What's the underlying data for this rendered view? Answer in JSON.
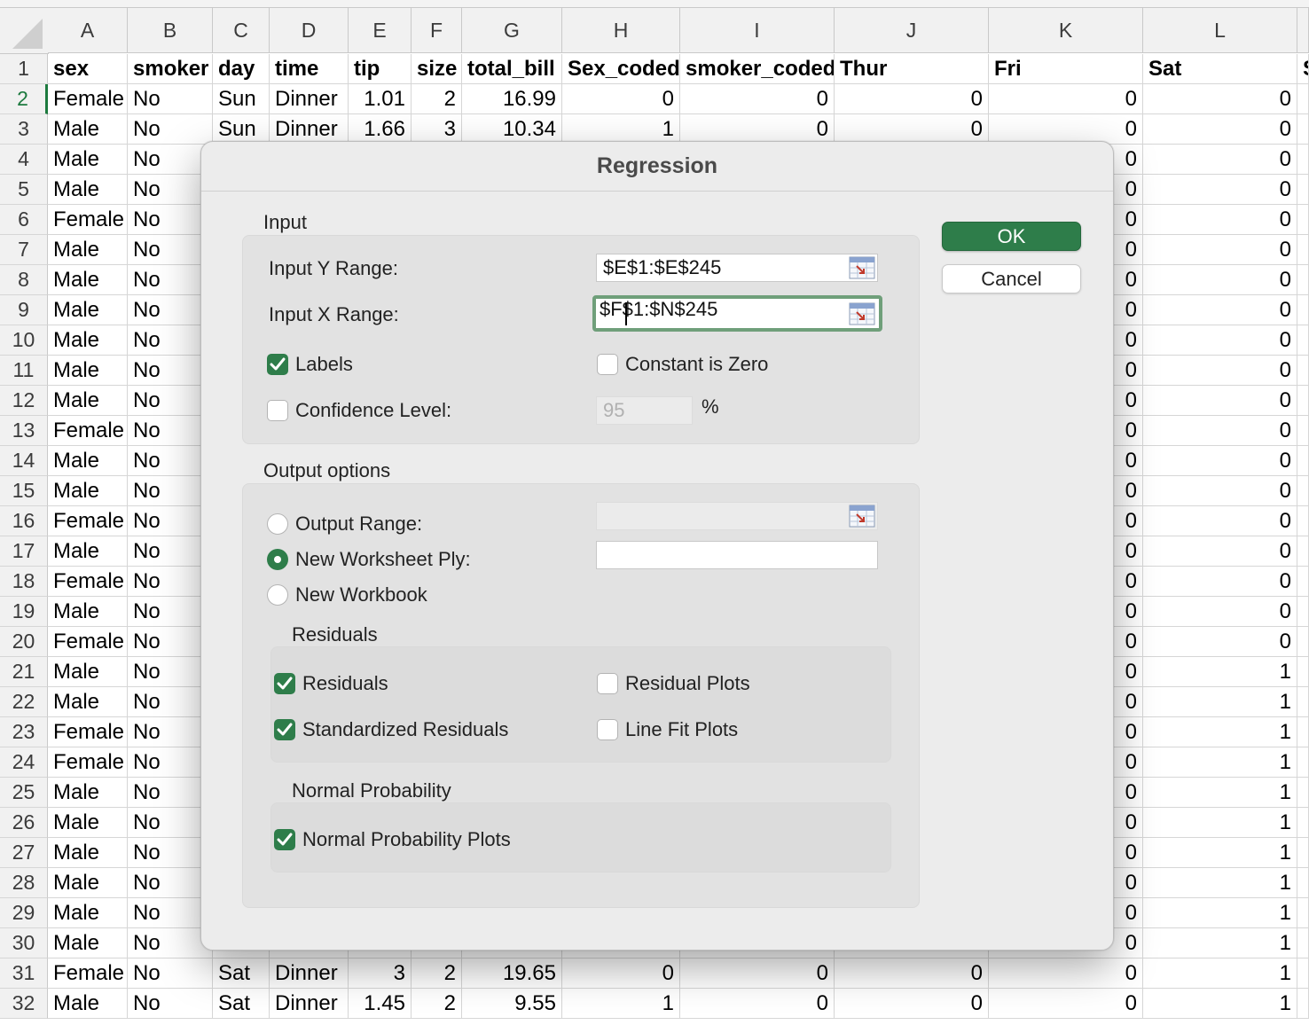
{
  "sheet": {
    "columns": [
      "A",
      "B",
      "C",
      "D",
      "E",
      "F",
      "G",
      "H",
      "I",
      "J",
      "K",
      "L"
    ],
    "header_row": {
      "A": "sex",
      "B": "smoker",
      "C": "day",
      "D": "time",
      "E": "tip",
      "F": "size",
      "G": "total_bill",
      "H": "Sex_coded",
      "I": "smoker_coded",
      "J": "Thur",
      "K": "Fri",
      "L": "Sat",
      "M": "S"
    },
    "rows": [
      {
        "n": "1"
      },
      {
        "n": "2",
        "A": "Female",
        "B": "No",
        "C": "Sun",
        "D": "Dinner",
        "E": "1.01",
        "F": "2",
        "G": "16.99",
        "H": "0",
        "I": "0",
        "J": "0",
        "K": "0",
        "L": "0"
      },
      {
        "n": "3",
        "A": "Male",
        "B": "No",
        "C": "Sun",
        "D": "Dinner",
        "E": "1.66",
        "F": "3",
        "G": "10.34",
        "H": "1",
        "I": "0",
        "J": "0",
        "K": "0",
        "L": "0"
      },
      {
        "n": "4",
        "A": "Male",
        "B": "No",
        "K": "0",
        "L": "0"
      },
      {
        "n": "5",
        "A": "Male",
        "B": "No",
        "K": "0",
        "L": "0"
      },
      {
        "n": "6",
        "A": "Female",
        "B": "No",
        "K": "0",
        "L": "0"
      },
      {
        "n": "7",
        "A": "Male",
        "B": "No",
        "K": "0",
        "L": "0"
      },
      {
        "n": "8",
        "A": "Male",
        "B": "No",
        "K": "0",
        "L": "0"
      },
      {
        "n": "9",
        "A": "Male",
        "B": "No",
        "K": "0",
        "L": "0"
      },
      {
        "n": "10",
        "A": "Male",
        "B": "No",
        "K": "0",
        "L": "0"
      },
      {
        "n": "11",
        "A": "Male",
        "B": "No",
        "K": "0",
        "L": "0"
      },
      {
        "n": "12",
        "A": "Male",
        "B": "No",
        "K": "0",
        "L": "0"
      },
      {
        "n": "13",
        "A": "Female",
        "B": "No",
        "K": "0",
        "L": "0"
      },
      {
        "n": "14",
        "A": "Male",
        "B": "No",
        "K": "0",
        "L": "0"
      },
      {
        "n": "15",
        "A": "Male",
        "B": "No",
        "K": "0",
        "L": "0"
      },
      {
        "n": "16",
        "A": "Female",
        "B": "No",
        "K": "0",
        "L": "0"
      },
      {
        "n": "17",
        "A": "Male",
        "B": "No",
        "K": "0",
        "L": "0"
      },
      {
        "n": "18",
        "A": "Female",
        "B": "No",
        "K": "0",
        "L": "0"
      },
      {
        "n": "19",
        "A": "Male",
        "B": "No",
        "K": "0",
        "L": "0"
      },
      {
        "n": "20",
        "A": "Female",
        "B": "No",
        "K": "0",
        "L": "0"
      },
      {
        "n": "21",
        "A": "Male",
        "B": "No",
        "K": "0",
        "L": "1"
      },
      {
        "n": "22",
        "A": "Male",
        "B": "No",
        "K": "0",
        "L": "1"
      },
      {
        "n": "23",
        "A": "Female",
        "B": "No",
        "K": "0",
        "L": "1"
      },
      {
        "n": "24",
        "A": "Female",
        "B": "No",
        "K": "0",
        "L": "1"
      },
      {
        "n": "25",
        "A": "Male",
        "B": "No",
        "K": "0",
        "L": "1"
      },
      {
        "n": "26",
        "A": "Male",
        "B": "No",
        "K": "0",
        "L": "1"
      },
      {
        "n": "27",
        "A": "Male",
        "B": "No",
        "K": "0",
        "L": "1"
      },
      {
        "n": "28",
        "A": "Male",
        "B": "No",
        "K": "0",
        "L": "1"
      },
      {
        "n": "29",
        "A": "Male",
        "B": "No",
        "K": "0",
        "L": "1"
      },
      {
        "n": "30",
        "A": "Male",
        "B": "No",
        "K": "0",
        "L": "1"
      },
      {
        "n": "31",
        "A": "Female",
        "B": "No",
        "C": "Sat",
        "D": "Dinner",
        "E": "3",
        "F": "2",
        "G": "19.65",
        "H": "0",
        "I": "0",
        "J": "0",
        "K": "0",
        "L": "1"
      },
      {
        "n": "32",
        "A": "Male",
        "B": "No",
        "C": "Sat",
        "D": "Dinner",
        "E": "1.45",
        "F": "2",
        "G": "9.55",
        "H": "1",
        "I": "0",
        "J": "0",
        "K": "0",
        "L": "1"
      }
    ],
    "selected_row": "2",
    "accent_color": "#1d7a3f"
  },
  "dialog": {
    "title": "Regression",
    "input_section": "Input",
    "input_y_label": "Input Y Range:",
    "input_y_value": "$E$1:$E$245",
    "input_x_label": "Input X Range:",
    "input_x_value": "$F$1:$N$245",
    "labels_label": "Labels",
    "labels_checked": true,
    "constant_zero_label": "Constant is Zero",
    "constant_zero_checked": false,
    "confidence_label": "Confidence Level:",
    "confidence_checked": false,
    "confidence_value": "95",
    "percent": "%",
    "output_section": "Output options",
    "output_range_label": "Output Range:",
    "output_range_value": "",
    "new_ply_label": "New Worksheet Ply:",
    "new_ply_value": "",
    "new_workbook_label": "New Workbook",
    "output_choice": "New Worksheet Ply",
    "residuals_section": "Residuals",
    "residuals_label": "Residuals",
    "residuals_checked": true,
    "residual_plots_label": "Residual Plots",
    "residual_plots_checked": false,
    "std_residuals_label": "Standardized Residuals",
    "std_residuals_checked": true,
    "line_fit_label": "Line Fit Plots",
    "line_fit_checked": false,
    "normal_section": "Normal Probability",
    "normal_plots_label": "Normal Probability Plots",
    "normal_plots_checked": true,
    "ok_label": "OK",
    "cancel_label": "Cancel",
    "primary_color": "#2e7d4a",
    "picker_icon": "range-picker-icon"
  }
}
